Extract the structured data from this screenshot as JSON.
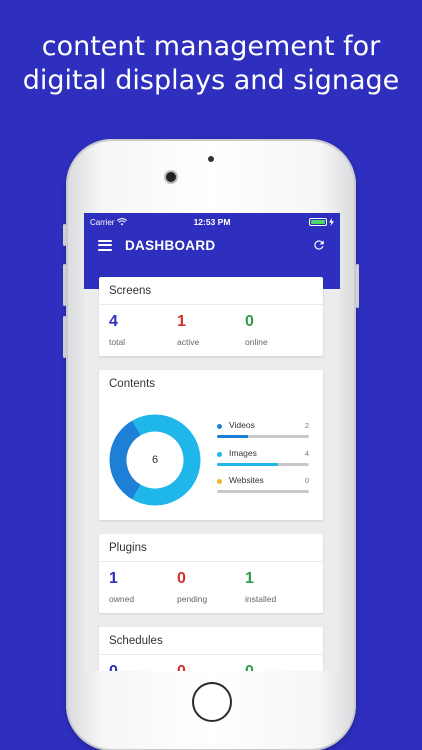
{
  "headline": {
    "line1": "content management for",
    "line2": "digital displays and signage"
  },
  "status_bar": {
    "carrier": "Carrier",
    "time": "12:53 PM",
    "battery_color": "#4cd964"
  },
  "app_bar": {
    "title": "DASHBOARD",
    "menu_icon": "hamburger-menu-icon",
    "refresh_icon": "refresh-icon",
    "color": "#2e2fbf"
  },
  "screens_card": {
    "title": "Screens",
    "stats": [
      {
        "value": "4",
        "label": "total",
        "color": "#2e2fbf"
      },
      {
        "value": "1",
        "label": "active",
        "color": "#d32f2f"
      },
      {
        "value": "0",
        "label": "online",
        "color": "#2e9e4a"
      }
    ]
  },
  "contents_card": {
    "title": "Contents",
    "total": "6",
    "items": [
      {
        "label": "Videos",
        "count": "2",
        "fraction": 0.333,
        "color": "#1e7fd6"
      },
      {
        "label": "Images",
        "count": "4",
        "fraction": 0.667,
        "color": "#1fb6ea"
      },
      {
        "label": "Websites",
        "count": "0",
        "fraction": 0,
        "color": "#f5b52e"
      }
    ]
  },
  "plugins_card": {
    "title": "Plugins",
    "stats": [
      {
        "value": "1",
        "label": "owned",
        "color": "#2e2fbf"
      },
      {
        "value": "0",
        "label": "pending",
        "color": "#d32f2f"
      },
      {
        "value": "1",
        "label": "installed",
        "color": "#2e9e4a"
      }
    ]
  },
  "schedules_card": {
    "title": "Schedules",
    "stats": [
      {
        "value": "0",
        "color": "#2e2fbf"
      },
      {
        "value": "0",
        "color": "#d32f2f"
      },
      {
        "value": "0",
        "color": "#2e9e4a"
      }
    ]
  }
}
